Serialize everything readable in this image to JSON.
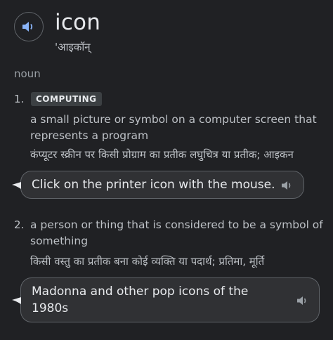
{
  "entry": {
    "word": "icon",
    "pronunciation": "'आइकॉन्",
    "part_of_speech": "noun"
  },
  "senses": [
    {
      "number": "1.",
      "label": "COMPUTING",
      "definition_line1": "a small picture or symbol on a computer screen that",
      "definition_line2": "represents a program",
      "translation": "कंप्यूटर स्क्रीन पर किसी प्रोग्राम का प्रतीक लघुचित्र या प्रतीक; आइकन",
      "example": "Click on the printer icon with the mouse."
    },
    {
      "number": "2.",
      "definition_line1": "a person or thing that is considered to be a symbol of",
      "definition_line2": "something",
      "translation": "किसी वस्तु का प्रतीक बना कोई व्यक्ति या पदार्थ; प्रतिमा, मूर्ति",
      "example_line1": "Madonna and other pop icons of the",
      "example_line2": "1980s"
    }
  ],
  "icons": {
    "pronounce": "speaker-icon",
    "example_audio": "speaker-icon"
  },
  "colors": {
    "background": "#202124",
    "text": "#bdc1c6",
    "accent": "#8ab4f8"
  }
}
